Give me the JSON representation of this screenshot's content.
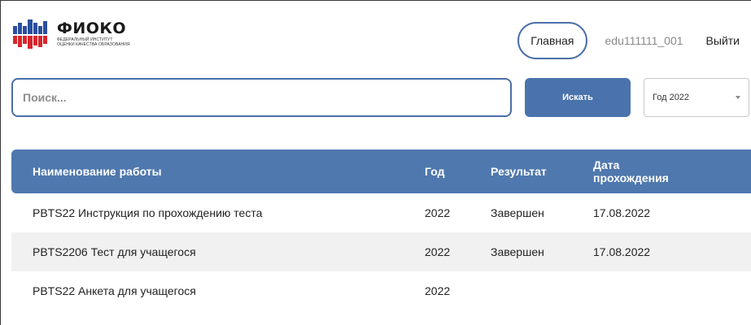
{
  "header": {
    "logo": {
      "title": "ФИОКО",
      "subtitle_line1": "ФЕДЕРАЛЬНЫЙ ИНСТИТУТ",
      "subtitle_line2": "ОЦЕНКИ КАЧЕСТВА ОБРАЗОВАНИЯ"
    },
    "nav": {
      "home": "Главная",
      "user": "edu111111_001",
      "logout": "Выйти"
    }
  },
  "search": {
    "placeholder": "Поиск...",
    "value": "",
    "button_label": "Искать",
    "year_select": "Год 2022"
  },
  "table": {
    "headers": {
      "name": "Наименование работы",
      "year": "Год",
      "result": "Результат",
      "date_line1": "Дата",
      "date_line2": "прохождения"
    },
    "rows": [
      {
        "name": "PBTS22 Инструкция по прохождению теста",
        "year": "2022",
        "result": "Завершен",
        "date": "17.08.2022"
      },
      {
        "name": "PBTS2206 Тест для учащегося",
        "year": "2022",
        "result": "Завершен",
        "date": "17.08.2022"
      },
      {
        "name": "PBTS22 Анкета для учащегося",
        "year": "2022",
        "result": "",
        "date": ""
      }
    ]
  },
  "colors": {
    "accent": "#4a73ad",
    "header_bg": "#4f78ae",
    "logo_blue": "#2b4f9e",
    "logo_red": "#d7262c"
  }
}
